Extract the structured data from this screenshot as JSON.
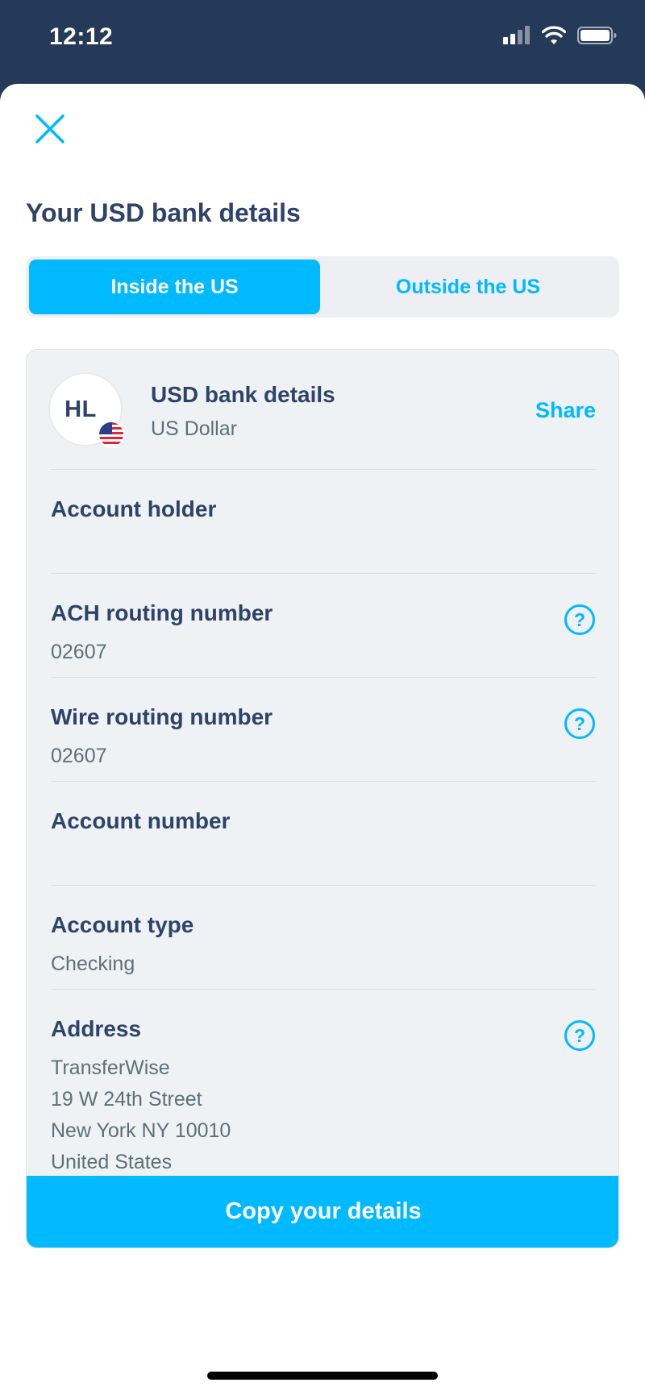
{
  "status_bar": {
    "time": "12:12"
  },
  "page": {
    "title": "Your USD bank details"
  },
  "tabs": [
    {
      "label": "Inside the US",
      "selected": true
    },
    {
      "label": "Outside the US",
      "selected": false
    }
  ],
  "account": {
    "avatar_initials": "HL",
    "title": "USD bank details",
    "currency": "US Dollar",
    "share_label": "Share"
  },
  "details": [
    {
      "label": "Account holder",
      "value": "",
      "help_icon": false
    },
    {
      "label": "ACH routing number",
      "value": "02607",
      "help_icon": true
    },
    {
      "label": "Wire routing number",
      "value": "02607",
      "help_icon": true
    },
    {
      "label": "Account number",
      "value": "",
      "help_icon": false
    },
    {
      "label": "Account type",
      "value": "Checking",
      "help_icon": false
    },
    {
      "label": "Address",
      "value_lines": [
        "TransferWise",
        "19 W 24th Street",
        "New York NY 10010",
        "United States"
      ],
      "help_icon": true
    }
  ],
  "copy_button": {
    "label": "Copy your details"
  },
  "colors": {
    "accent": "#00b9ff",
    "navy": "#2e4369",
    "header_bg": "#253a59",
    "card_bg": "#eff2f5"
  }
}
